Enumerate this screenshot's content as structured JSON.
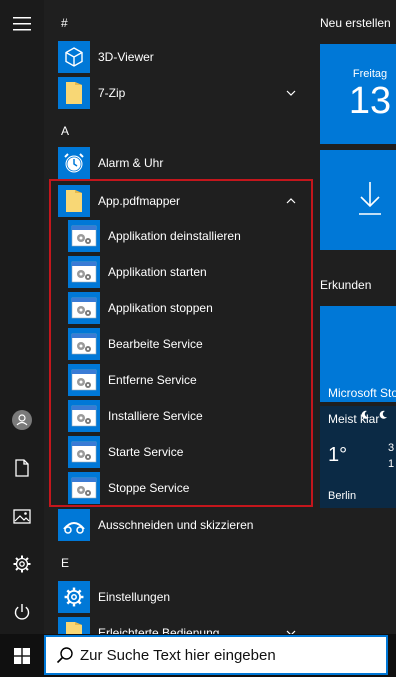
{
  "applist": {
    "section_hash": "#",
    "section_a": "A",
    "section_e": "E",
    "apps": {
      "viewer3d": "3D-Viewer",
      "zip": "7-Zip",
      "alarm": "Alarm & Uhr",
      "pdfmapper": "App.pdfmapper",
      "snip": "Ausschneiden und skizzieren",
      "settings": "Einstellungen",
      "ease": "Erleichterte Bedienung"
    },
    "pdfmapper_items": [
      "Applikation deinstallieren",
      "Applikation starten",
      "Applikation stoppen",
      "Bearbeite Service",
      "Entferne Service",
      "Installiere Service",
      "Starte Service",
      "Stoppe Service"
    ]
  },
  "tiles": {
    "group1": "Neu erstellen",
    "calendar_day": "Freitag",
    "calendar_date": "13",
    "group2": "Erkunden",
    "store": "Microsoft Sto",
    "weather_condition": "Meist klar",
    "weather_temp": "1°",
    "weather_side": "3",
    "weather_side2": "1",
    "weather_city": "Berlin"
  },
  "search": {
    "placeholder": "Zur Suche Text hier eingeben"
  },
  "colors": {
    "accent": "#0078d7",
    "highlight_border": "#c4161c",
    "background": "#1f1f1f"
  }
}
